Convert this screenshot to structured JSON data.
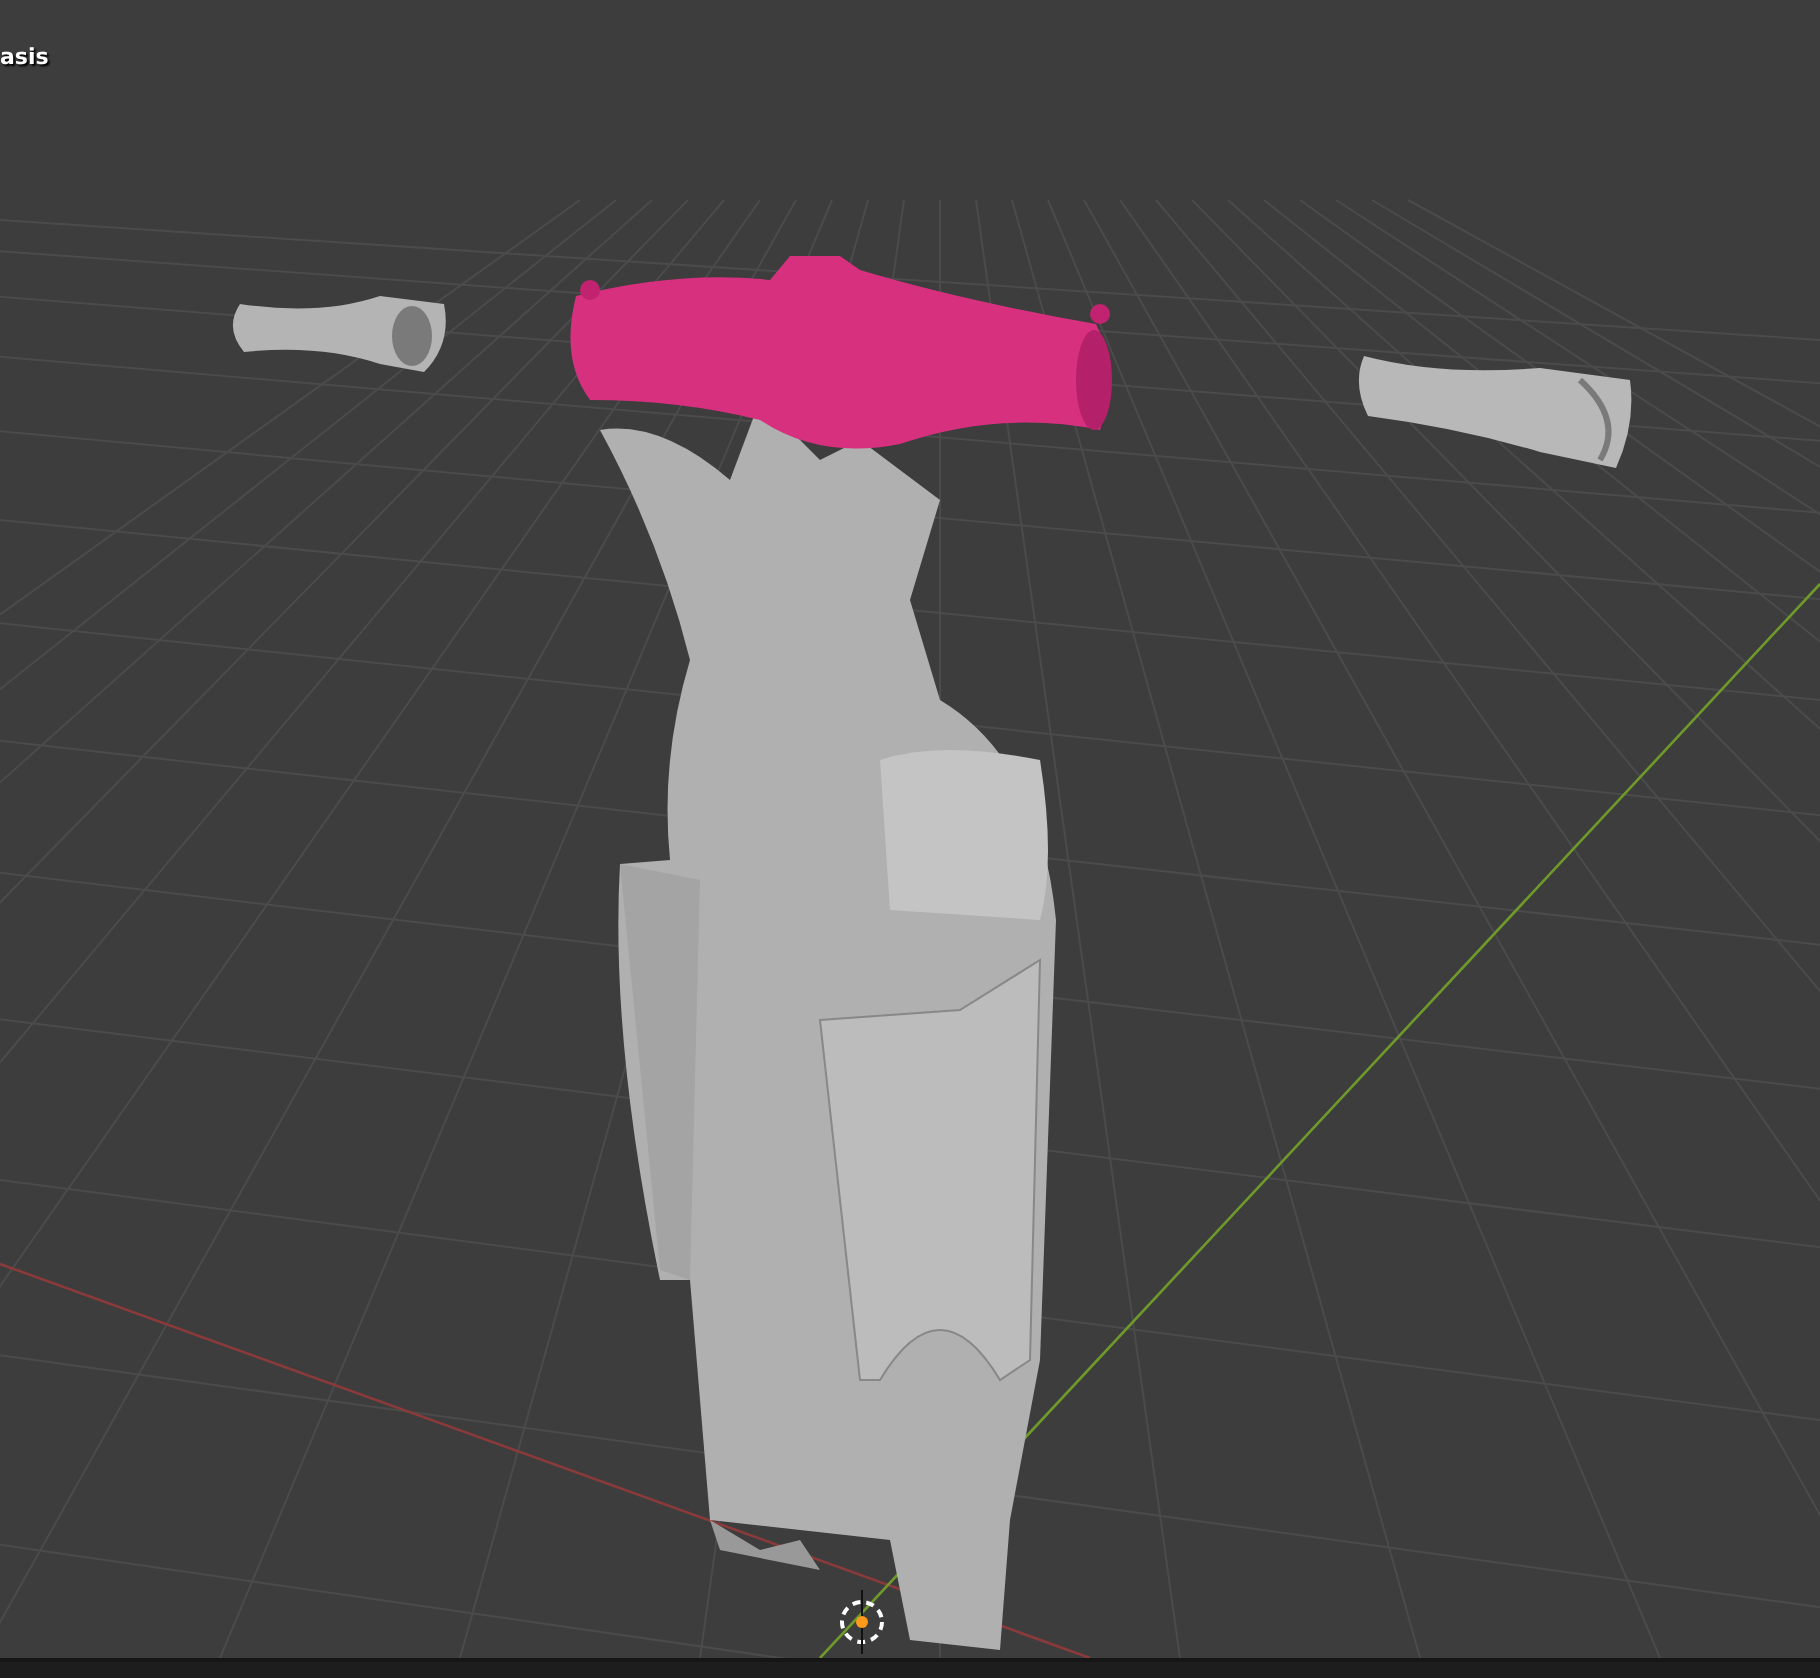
{
  "viewport": {
    "label": "asis"
  }
}
